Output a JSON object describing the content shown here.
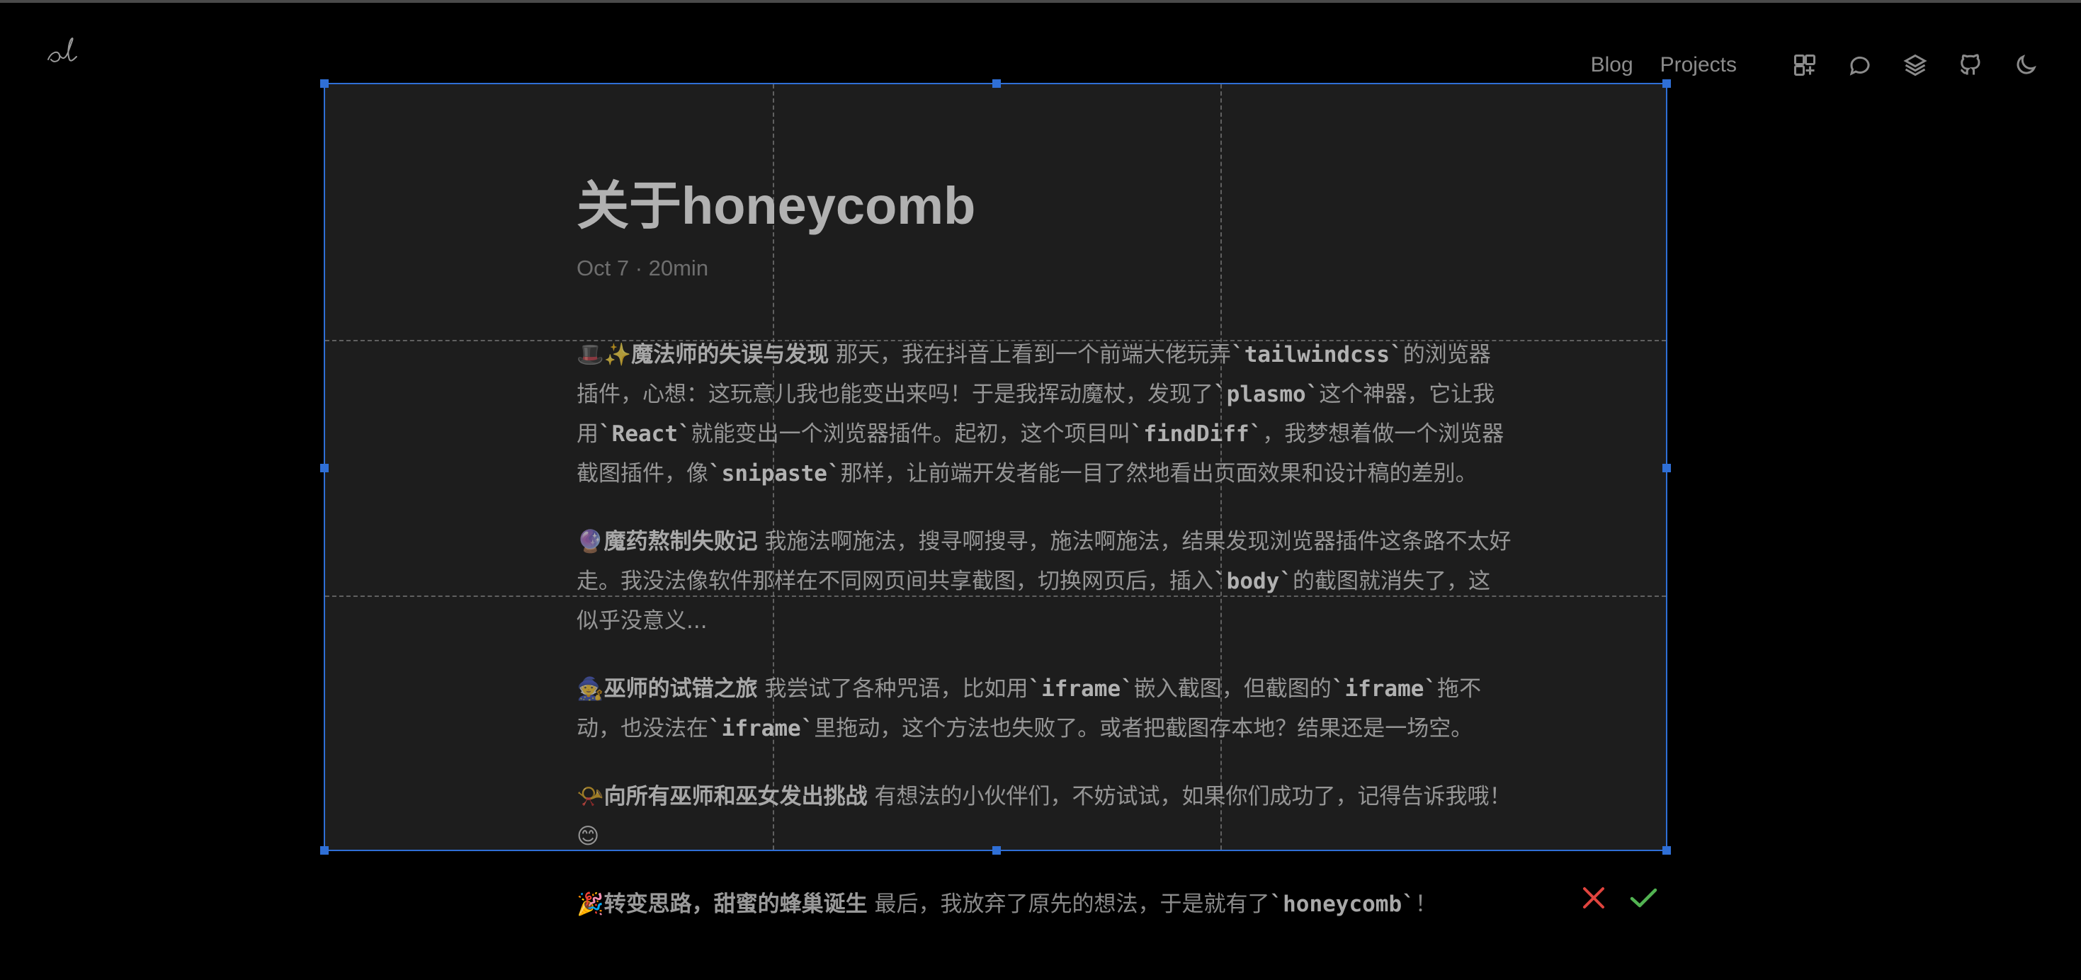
{
  "nav": {
    "links": [
      "Blog",
      "Projects"
    ],
    "icons": [
      "template-icon",
      "chat-icon",
      "layers-icon",
      "github-icon",
      "moon-icon"
    ]
  },
  "article": {
    "title": "关于honeycomb",
    "meta": "Oct 7 · 20min",
    "paragraphs": [
      {
        "emoji": "🎩✨",
        "lead": "魔法师的失误与发现",
        "parts": [
          "那天，我在抖音上看到一个前端大佬玩弄",
          "`tailwindcss`",
          "的浏览器插件，心想：这玩意儿我也能变出来吗！于是我挥动魔杖，发现了",
          "`plasmo`",
          "这个神器，它让我用",
          "`React`",
          "就能变出一个浏览器插件。起初，这个项目叫",
          "`findDiff`",
          "，我梦想着做一个浏览器截图插件，像",
          "`snipaste`",
          "那样，让前端开发者能一目了然地看出页面效果和设计稿的差别。"
        ]
      },
      {
        "emoji": "🔮",
        "lead": "魔药熬制失败记",
        "parts": [
          "我施法啊施法，搜寻啊搜寻，施法啊施法，结果发现浏览器插件这条路不太好走。我没法像软件那样在不同网页间共享截图，切换网页后，插入",
          "`body`",
          "的截图就消失了，这似乎没意义..."
        ]
      },
      {
        "emoji": "🧙",
        "lead": "巫师的试错之旅",
        "parts": [
          "我尝试了各种咒语，比如用",
          "`iframe`",
          "嵌入截图，但截图的",
          "`iframe`",
          "拖不动，也没法在",
          "`iframe`",
          "里拖动，这个方法也失败了。或者把截图存本地？结果还是一场空。"
        ]
      },
      {
        "emoji": "📯",
        "lead": "向所有巫师和巫女发出挑战",
        "parts": [
          "有想法的小伙伴们，不妨试试，如果你们成功了，记得告诉我哦！😊"
        ]
      },
      {
        "emoji": "🎉",
        "lead": "转变思路，甜蜜的蜂巢诞生",
        "parts": [
          "最后，我放弃了原先的想法，于是就有了",
          "`honeycomb`",
          "！"
        ]
      }
    ]
  },
  "colors": {
    "background": "#000000",
    "selection_border": "#2f6fd6",
    "cancel": "#e0443e",
    "confirm": "#52b352"
  }
}
